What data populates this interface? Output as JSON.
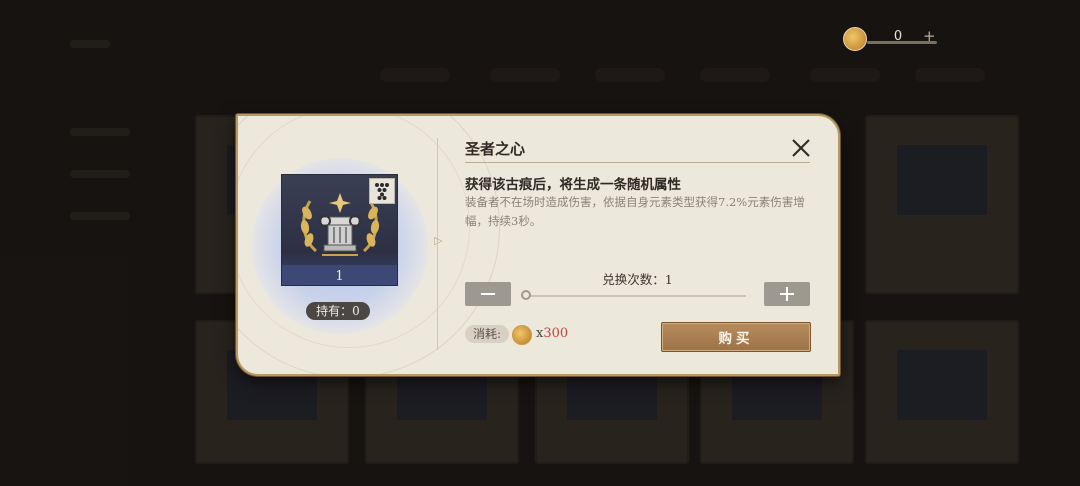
{
  "currency": {
    "amount": "0",
    "plus": "+"
  },
  "dialog": {
    "title": "圣者之心",
    "subtitle": "获得该古痕后，将生成一条随机属性",
    "description": "装备者不在场时造成伤害，依据自身元素类型获得7.2%元素伤害增幅，持续3秒。",
    "item": {
      "count": "1"
    },
    "hold_label": "持有：0",
    "exchange_label": "兑换次数：1",
    "exchange_count": 1,
    "cost_label": "消耗:",
    "cost_prefix": "x",
    "cost_value": "300",
    "buy_label": "购买"
  },
  "colors": {
    "buy_button": "#a57a4e",
    "cost_value": "#c8433a",
    "glow": "#b9c7ea"
  },
  "icons": [
    "coin-icon",
    "close-icon",
    "minus-icon",
    "plus-icon",
    "laurel-emblem-icon",
    "rank-badge-icon"
  ]
}
